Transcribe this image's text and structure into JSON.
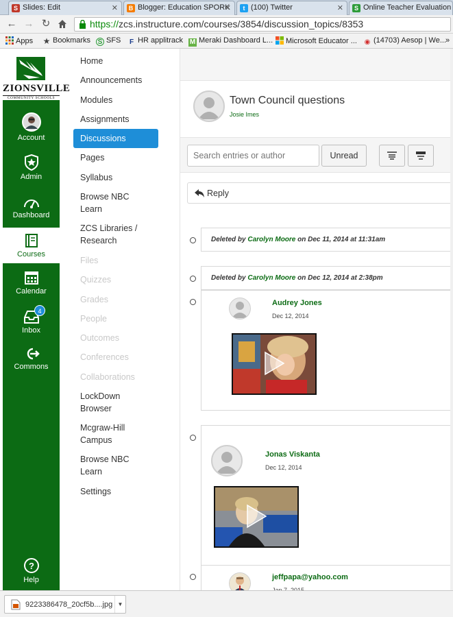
{
  "browser": {
    "tabs": [
      {
        "title": "Slides: Edit",
        "icon": "S",
        "color": "#c0392b"
      },
      {
        "title": "Blogger: Education SPORK",
        "icon": "B",
        "color": "#f57c00"
      },
      {
        "title": "(100) Twitter",
        "icon": "t",
        "color": "#1da1f2"
      },
      {
        "title": "Online Teacher Evaluation",
        "icon": "S",
        "color": "#2e9c3a"
      }
    ],
    "close_glyph": "✕",
    "url_secure": "https://",
    "url_rest": "zcs.instructure.com/courses/3854/discussion_topics/8353",
    "bookmarks": [
      {
        "label": "Apps",
        "icon": "apps-grid-icon"
      },
      {
        "label": "Bookmarks",
        "icon": "star-icon"
      },
      {
        "label": "SFS",
        "icon": "sfs-icon"
      },
      {
        "label": "HR applitrack",
        "icon": "flag-icon"
      },
      {
        "label": "Meraki Dashboard L...",
        "icon": "meraki-icon"
      },
      {
        "label": "Microsoft Educator ...",
        "icon": "microsoft-icon"
      },
      {
        "label": "(14703) Aesop | We...",
        "icon": "aesop-icon"
      }
    ]
  },
  "brand": {
    "name": "ZIONSVILLE",
    "sub": "COMMUNITY SCHOOLS",
    "green": "#0c6b14",
    "blue": "#1e8ed8"
  },
  "global_nav": {
    "items": [
      {
        "label": "Account",
        "icon": "user-avatar-icon"
      },
      {
        "label": "Admin",
        "icon": "shield-star-icon"
      },
      {
        "label": "Dashboard",
        "icon": "speedometer-icon"
      },
      {
        "label": "Courses",
        "icon": "book-icon"
      },
      {
        "label": "Calendar",
        "icon": "calendar-icon"
      },
      {
        "label": "Inbox",
        "icon": "inbox-icon",
        "badge": "4"
      },
      {
        "label": "Commons",
        "icon": "commons-arrow-icon"
      },
      {
        "label": "Help",
        "icon": "help-icon"
      }
    ]
  },
  "course_nav": {
    "items": [
      {
        "label": "Home",
        "state": "enabled"
      },
      {
        "label": "Announcements",
        "state": "enabled"
      },
      {
        "label": "Modules",
        "state": "enabled"
      },
      {
        "label": "Assignments",
        "state": "enabled"
      },
      {
        "label": "Discussions",
        "state": "active"
      },
      {
        "label": "Pages",
        "state": "enabled"
      },
      {
        "label": "Syllabus",
        "state": "enabled"
      },
      {
        "label": "Browse NBC Learn",
        "state": "enabled"
      },
      {
        "label": "ZCS Libraries / Research",
        "state": "enabled"
      },
      {
        "label": "Files",
        "state": "disabled"
      },
      {
        "label": "Quizzes",
        "state": "disabled"
      },
      {
        "label": "Grades",
        "state": "disabled"
      },
      {
        "label": "People",
        "state": "disabled"
      },
      {
        "label": "Outcomes",
        "state": "disabled"
      },
      {
        "label": "Conferences",
        "state": "disabled"
      },
      {
        "label": "Collaborations",
        "state": "disabled"
      },
      {
        "label": "LockDown Browser",
        "state": "enabled"
      },
      {
        "label": "Mcgraw-Hill Campus",
        "state": "enabled"
      },
      {
        "label": "Browse NBC Learn",
        "state": "enabled"
      },
      {
        "label": "Settings",
        "state": "enabled"
      }
    ]
  },
  "topic": {
    "title": "Town Council questions",
    "author": "Josie Imes"
  },
  "toolbar": {
    "search_placeholder": "Search entries or author",
    "unread_label": "Unread",
    "reply_label": "Reply"
  },
  "entries": {
    "deleted": [
      {
        "prefix": "Deleted by ",
        "who": "Carolyn Moore",
        "suffix": " on Dec 11, 2014 at 11:31am"
      },
      {
        "prefix": "Deleted by ",
        "who": "Carolyn Moore",
        "suffix": " on Dec 12, 2014 at 2:38pm"
      }
    ],
    "posts": [
      {
        "name": "Audrey Jones",
        "date": "Dec 12, 2014"
      },
      {
        "name": "Jonas Viskanta",
        "date": "Dec 12, 2014"
      },
      {
        "name": "jeffpapa@yahoo.com",
        "date": "Jan 7, 2015"
      }
    ]
  },
  "download": {
    "filename": "9223386478_20cf5b....jpg"
  }
}
